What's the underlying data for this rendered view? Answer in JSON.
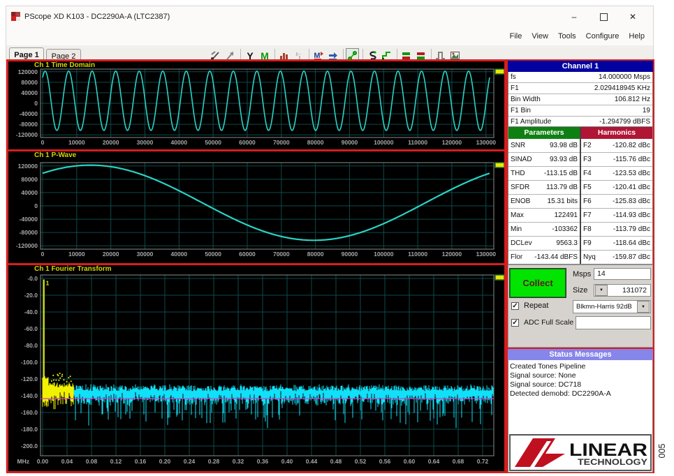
{
  "window": {
    "title": "PScope XD K103 - DC2290A-A (LTC2387)"
  },
  "window_controls": {
    "minimize": "–",
    "maximize": "",
    "close": "✕"
  },
  "menu": {
    "items": [
      "File",
      "View",
      "Tools",
      "Configure",
      "Help"
    ]
  },
  "tabs": [
    {
      "label": "Page 1",
      "active": true
    },
    {
      "label": "Page 2",
      "active": false
    }
  ],
  "toolbar": {
    "icons": [
      {
        "name": "pan-tool-icon",
        "kind": "tools"
      },
      {
        "name": "zoom-arrow-icon",
        "kind": "arrow"
      },
      {
        "name": "y-scale-icon",
        "kind": "yletter"
      },
      {
        "name": "multi-waveform-icon",
        "kind": "mgreen"
      },
      {
        "name": "histogram-icon",
        "kind": "bars"
      },
      {
        "name": "half-scale-icon",
        "kind": "fraction"
      },
      {
        "name": "average-icon",
        "kind": "mavg"
      },
      {
        "name": "continuous-collect-icon",
        "kind": "bluearrow"
      },
      {
        "name": "node-link-icon",
        "kind": "nodes",
        "pressed": true
      },
      {
        "name": "s-curve-icon",
        "kind": "scurve"
      },
      {
        "name": "step-line-icon",
        "kind": "stepline"
      },
      {
        "name": "dual-trace-icon",
        "kind": "dualbar"
      },
      {
        "name": "dual-trace-alt-icon",
        "kind": "dualbar2"
      },
      {
        "name": "square-wave-icon",
        "kind": "sqwave"
      },
      {
        "name": "export-image-icon",
        "kind": "image"
      }
    ]
  },
  "channel_panel": {
    "title": "Channel 1",
    "rows": [
      {
        "label": "fs",
        "value": "14.000000 Msps"
      },
      {
        "label": "F1",
        "value": "2.029418945 KHz"
      },
      {
        "label": "Bin Width",
        "value": "106.812 Hz"
      },
      {
        "label": "F1 Bin",
        "value": "19"
      },
      {
        "label": "F1 Amplitude",
        "value": "-1.294799 dBFS"
      }
    ]
  },
  "parameters": {
    "title": "Parameters",
    "rows": [
      {
        "label": "SNR",
        "value": "93.98 dB"
      },
      {
        "label": "SINAD",
        "value": "93.93 dB"
      },
      {
        "label": "THD",
        "value": "-113.15 dB"
      },
      {
        "label": "SFDR",
        "value": "113.79 dB"
      },
      {
        "label": "ENOB",
        "value": "15.31 bits"
      },
      {
        "label": "Max",
        "value": "122491"
      },
      {
        "label": "Min",
        "value": "-103362"
      },
      {
        "label": "DCLev",
        "value": "9563.3"
      },
      {
        "label": "Flor",
        "value": "-143.44 dBFS"
      }
    ]
  },
  "harmonics": {
    "title": "Harmonics",
    "rows": [
      {
        "label": "F2",
        "value": "-120.82 dBc"
      },
      {
        "label": "F3",
        "value": "-115.76 dBc"
      },
      {
        "label": "F4",
        "value": "-123.53 dBc"
      },
      {
        "label": "F5",
        "value": "-120.41 dBc"
      },
      {
        "label": "F6",
        "value": "-125.83 dBc"
      },
      {
        "label": "F7",
        "value": "-114.93 dBc"
      },
      {
        "label": "F8",
        "value": "-113.79 dBc"
      },
      {
        "label": "F9",
        "value": "-118.64 dBc"
      },
      {
        "label": "Nyq",
        "value": "-159.87 dBc"
      }
    ]
  },
  "acquisition": {
    "collect_label": "Collect",
    "msps_label": "Msps",
    "msps_value": "14",
    "size_label": "Size",
    "size_value": "131072",
    "repeat_label": "Repeat",
    "repeat_checked": "✓",
    "window_value": "Blkmn-Harris 92dB",
    "adc_label": "ADC Full Scale",
    "adc_checked": "✓",
    "adc_value": ""
  },
  "status": {
    "title": "Status Messages",
    "lines": [
      "Created Tones Pipeline",
      "Signal source: None",
      "Signal source: DC718",
      "Detected demobd: DC2290A-A"
    ]
  },
  "logo": {
    "line1": "LINEAR",
    "line2": "TECHNOLOGY"
  },
  "figure_number": "005",
  "colors": {
    "border_red": "#d81d1d",
    "plot_bg": "#000000",
    "grid": "#0e4a4a",
    "wave_cyan": "#2ad2c4",
    "fft_cyan": "#10e0f8",
    "fft_yellow": "#f2f200",
    "floor_magenta": "#cc3fcc",
    "header_blue": "#0202a0",
    "header_green": "#0e8012",
    "header_crimson": "#b01535",
    "header_periwinkle": "#8585ea",
    "collect_green": "#00e400"
  },
  "chart_data": [
    {
      "type": "line",
      "title": "Ch 1 Time Domain",
      "x_tick_labels": [
        "0",
        "10000",
        "20000",
        "30000",
        "40000",
        "50000",
        "60000",
        "70000",
        "80000",
        "90000",
        "100000",
        "110000",
        "120000",
        "130000"
      ],
      "y_tick_labels": [
        "120000",
        "80000",
        "40000",
        "0",
        "-40000",
        "-80000",
        "-120000"
      ],
      "xlim": [
        0,
        132300
      ],
      "ylim": [
        -130000,
        130000
      ],
      "series": [
        {
          "name": "ch1",
          "model": "sine",
          "dc": 9563,
          "amplitude": 112926,
          "cycles": 19,
          "peak_sample": 736,
          "n_samples": 131072
        }
      ]
    },
    {
      "type": "line",
      "title": "Ch 1 P-Wave",
      "x_tick_labels": [
        "0",
        "10000",
        "20000",
        "30000",
        "40000",
        "50000",
        "60000",
        "70000",
        "80000",
        "90000",
        "100000",
        "110000",
        "120000",
        "130000"
      ],
      "y_tick_labels": [
        "120000",
        "80000",
        "40000",
        "0",
        "-40000",
        "-80000",
        "-120000"
      ],
      "xlim": [
        0,
        132300
      ],
      "ylim": [
        -130000,
        130000
      ],
      "series": [
        {
          "name": "ch1",
          "model": "sine",
          "dc": 9563,
          "amplitude": 112926,
          "cycles": 1,
          "peak_sample": 14000,
          "n_samples": 131072
        }
      ]
    },
    {
      "type": "fft",
      "title": "Ch 1 Fourier Transform",
      "x_axis_prefix": "MHz",
      "x_tick_labels": [
        "0.00",
        "0.04",
        "0.08",
        "0.12",
        "0.16",
        "0.20",
        "0.24",
        "0.28",
        "0.32",
        "0.36",
        "0.40",
        "0.44",
        "0.48",
        "0.52",
        "0.56",
        "0.60",
        "0.64",
        "0.68",
        "0.72"
      ],
      "y_tick_labels": [
        "-0.0",
        "-20.0",
        "-40.0",
        "-60.0",
        "-80.0",
        "-100.0",
        "-120.0",
        "-140.0",
        "-160.0",
        "-180.0",
        "-200.0"
      ],
      "xlim_mhz": [
        0,
        0.7383
      ],
      "ylim_db": [
        -200,
        0
      ],
      "fundamental": {
        "marker": "1",
        "freq_mhz": 0.00203,
        "amp_db": -1.29
      },
      "noise_floor_db": -143.44,
      "noise_mean_db": -140.5,
      "yellow_until_mhz": 0.05,
      "noise_seed": 20387
    }
  ]
}
